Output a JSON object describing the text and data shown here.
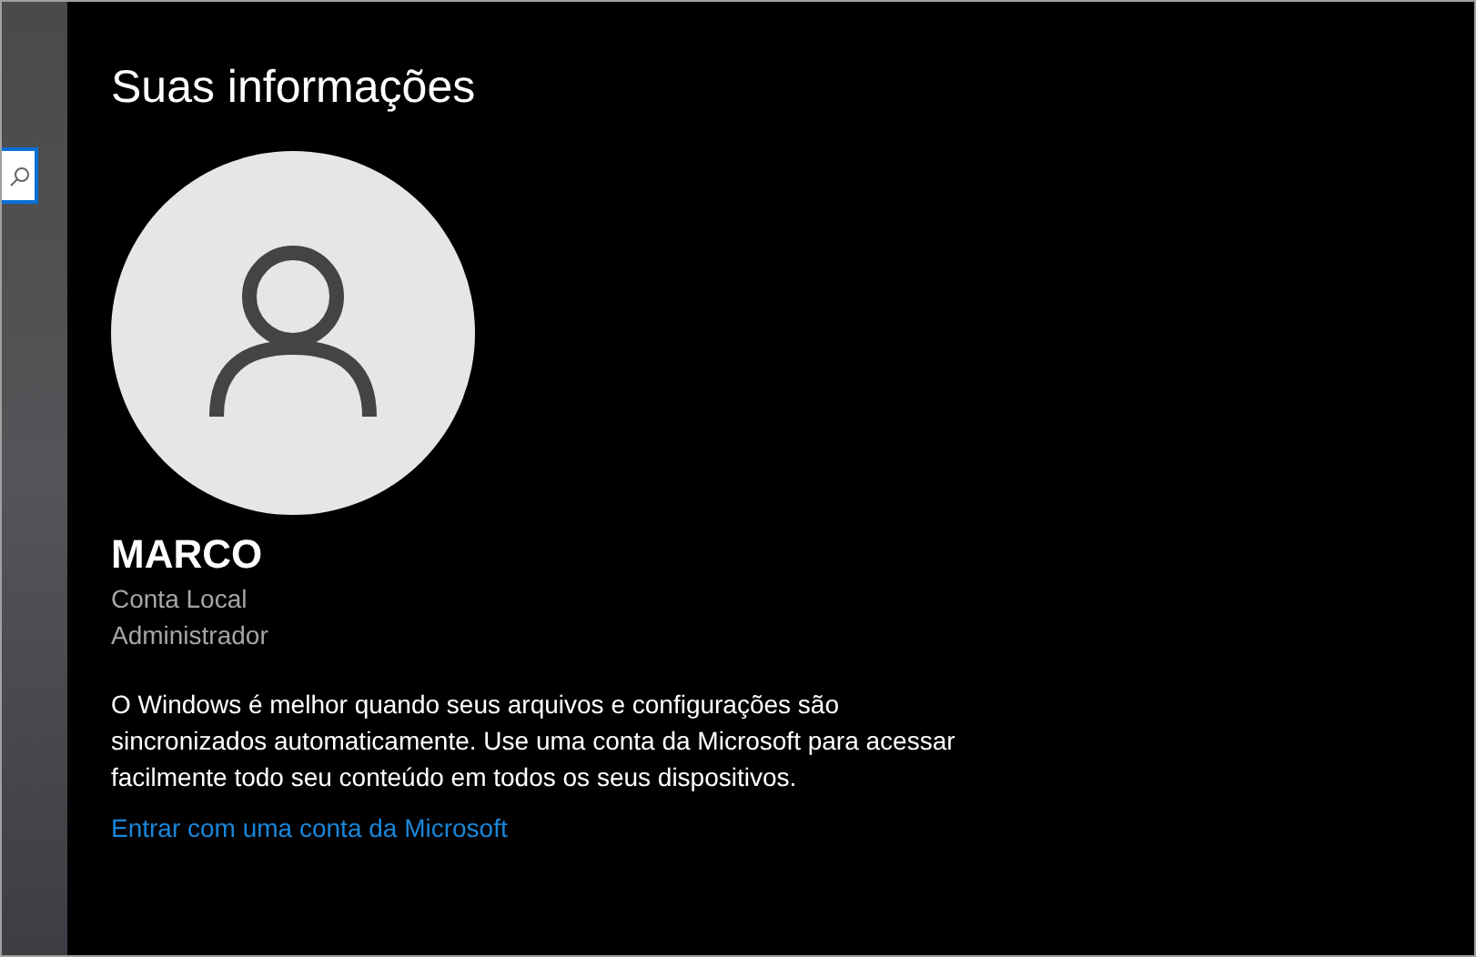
{
  "title": "Suas informações",
  "user": {
    "name": "MARCO",
    "account_type": "Conta Local",
    "role": "Administrador"
  },
  "description": "O Windows é melhor quando seus arquivos e configurações são sincronizados automaticamente. Use uma conta da Microsoft para acessar facilmente todo seu conteúdo em todos os seus dispositivos.",
  "link": "Entrar com uma conta da Microsoft"
}
